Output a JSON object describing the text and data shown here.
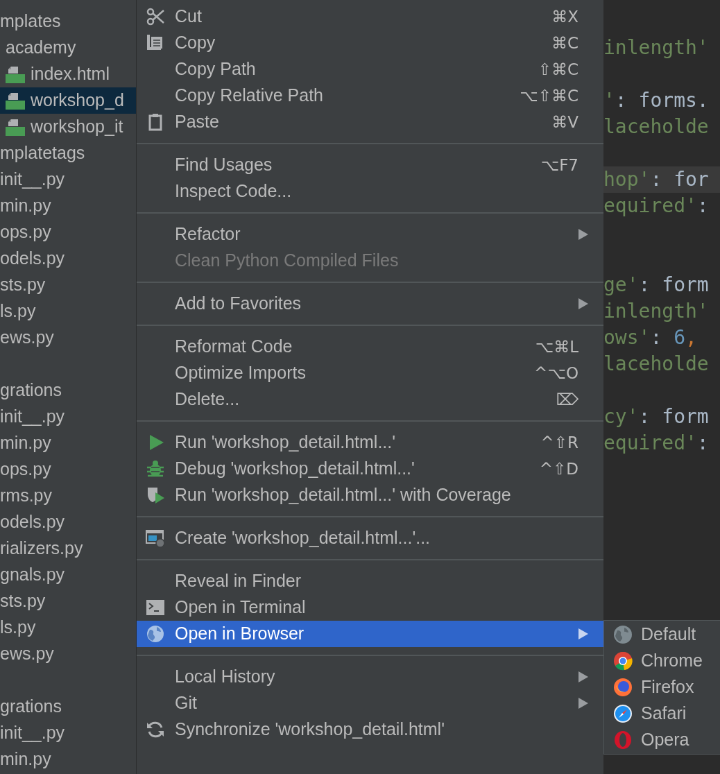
{
  "project_tree": [
    [
      {
        "label": "mplates",
        "kind": "folder",
        "selected": false
      },
      {
        "label": "academy",
        "kind": "folder",
        "selected": false
      },
      {
        "label": "index.html",
        "kind": "html",
        "selected": false
      },
      {
        "label": "workshop_d",
        "kind": "html",
        "selected": true
      },
      {
        "label": "workshop_it",
        "kind": "html",
        "selected": false
      },
      {
        "label": "mplatetags",
        "kind": "folder",
        "selected": false
      },
      {
        "label": "init__.py",
        "kind": "file",
        "selected": false
      },
      {
        "label": "min.py",
        "kind": "file",
        "selected": false
      },
      {
        "label": "ops.py",
        "kind": "file",
        "selected": false
      },
      {
        "label": "odels.py",
        "kind": "file",
        "selected": false
      },
      {
        "label": "sts.py",
        "kind": "file",
        "selected": false
      },
      {
        "label": "ls.py",
        "kind": "file",
        "selected": false
      },
      {
        "label": "ews.py",
        "kind": "file",
        "selected": false
      }
    ],
    [
      {
        "label": "grations",
        "kind": "folder",
        "selected": false
      },
      {
        "label": "init__.py",
        "kind": "file",
        "selected": false
      },
      {
        "label": "min.py",
        "kind": "file",
        "selected": false
      },
      {
        "label": "ops.py",
        "kind": "file",
        "selected": false
      },
      {
        "label": "rms.py",
        "kind": "file",
        "selected": false
      },
      {
        "label": "odels.py",
        "kind": "file",
        "selected": false
      },
      {
        "label": "rializers.py",
        "kind": "file",
        "selected": false
      },
      {
        "label": "gnals.py",
        "kind": "file",
        "selected": false
      },
      {
        "label": "sts.py",
        "kind": "file",
        "selected": false
      },
      {
        "label": "ls.py",
        "kind": "file",
        "selected": false
      },
      {
        "label": "ews.py",
        "kind": "file",
        "selected": false
      }
    ],
    [
      {
        "label": "grations",
        "kind": "folder",
        "selected": false
      },
      {
        "label": "init__.py",
        "kind": "file",
        "selected": false
      },
      {
        "label": "min.py",
        "kind": "file",
        "selected": false
      }
    ]
  ],
  "editor_blocks": [
    [
      {
        "current": false,
        "tokens": [
          {
            "kind": "str",
            "text": "inlength'"
          }
        ]
      }
    ],
    [
      {
        "current": false,
        "tokens": [
          {
            "kind": "str",
            "text": "'"
          },
          {
            "kind": "plain",
            "text": ": forms."
          }
        ]
      },
      {
        "current": false,
        "tokens": [
          {
            "kind": "str",
            "text": "laceholde"
          }
        ]
      }
    ],
    [
      {
        "current": true,
        "tokens": [
          {
            "kind": "str",
            "text": "hop'"
          },
          {
            "kind": "plain",
            "text": ": for"
          }
        ]
      },
      {
        "current": false,
        "tokens": [
          {
            "kind": "str",
            "text": "equired'"
          },
          {
            "kind": "plain",
            "text": ":"
          }
        ]
      }
    ],
    [
      {
        "current": false,
        "tokens": [
          {
            "kind": "str",
            "text": "ge'"
          },
          {
            "kind": "plain",
            "text": ": form"
          }
        ]
      },
      {
        "current": false,
        "tokens": [
          {
            "kind": "str",
            "text": "inlength'"
          }
        ]
      },
      {
        "current": false,
        "tokens": [
          {
            "kind": "str",
            "text": "ows'"
          },
          {
            "kind": "plain",
            "text": ": "
          },
          {
            "kind": "num",
            "text": "6"
          },
          {
            "kind": "punct",
            "text": ","
          }
        ]
      },
      {
        "current": false,
        "tokens": [
          {
            "kind": "str",
            "text": "laceholde"
          }
        ]
      }
    ],
    [
      {
        "current": false,
        "tokens": [
          {
            "kind": "str",
            "text": "cy'"
          },
          {
            "kind": "plain",
            "text": ": form"
          }
        ]
      },
      {
        "current": false,
        "tokens": [
          {
            "kind": "str",
            "text": "equired'"
          },
          {
            "kind": "plain",
            "text": ":"
          }
        ]
      }
    ]
  ],
  "context_menu": [
    [
      {
        "label": "Cut",
        "shortcut": "⌘X",
        "kind": "cut",
        "submenu": false,
        "disabled": false,
        "selected": false
      },
      {
        "label": "Copy",
        "shortcut": "⌘C",
        "kind": "copy",
        "submenu": false,
        "disabled": false,
        "selected": false
      },
      {
        "label": "Copy Path",
        "shortcut": "⇧⌘C",
        "kind": "plain",
        "submenu": false,
        "disabled": false,
        "selected": false
      },
      {
        "label": "Copy Relative Path",
        "shortcut": "⌥⇧⌘C",
        "kind": "plain",
        "submenu": false,
        "disabled": false,
        "selected": false
      },
      {
        "label": "Paste",
        "shortcut": "⌘V",
        "kind": "paste",
        "submenu": false,
        "disabled": false,
        "selected": false
      }
    ],
    [
      {
        "label": "Find Usages",
        "shortcut": "⌥F7",
        "kind": "plain",
        "submenu": false,
        "disabled": false,
        "selected": false
      },
      {
        "label": "Inspect Code...",
        "kind": "plain",
        "submenu": false,
        "disabled": false,
        "selected": false
      }
    ],
    [
      {
        "label": "Refactor",
        "kind": "plain",
        "submenu": true,
        "disabled": false,
        "selected": false
      },
      {
        "label": "Clean Python Compiled Files",
        "kind": "plain",
        "submenu": false,
        "disabled": true,
        "selected": false
      }
    ],
    [
      {
        "label": "Add to Favorites",
        "kind": "plain",
        "submenu": true,
        "disabled": false,
        "selected": false
      }
    ],
    [
      {
        "label": "Reformat Code",
        "shortcut": "⌥⌘L",
        "kind": "plain",
        "submenu": false,
        "disabled": false,
        "selected": false
      },
      {
        "label": "Optimize Imports",
        "shortcut": "^⌥O",
        "kind": "plain",
        "submenu": false,
        "disabled": false,
        "selected": false
      },
      {
        "label": "Delete...",
        "shortcut": "⌦",
        "kind": "plain",
        "submenu": false,
        "disabled": false,
        "selected": false
      }
    ],
    [
      {
        "label": "Run 'workshop_detail.html...'",
        "shortcut": "^⇧R",
        "kind": "run",
        "submenu": false,
        "disabled": false,
        "selected": false
      },
      {
        "label": "Debug 'workshop_detail.html...'",
        "shortcut": "^⇧D",
        "kind": "debug",
        "submenu": false,
        "disabled": false,
        "selected": false
      },
      {
        "label": "Run 'workshop_detail.html...' with Coverage",
        "kind": "coverage",
        "submenu": false,
        "disabled": false,
        "selected": false
      }
    ],
    [
      {
        "label": "Create 'workshop_detail.html...'...",
        "kind": "create",
        "submenu": false,
        "disabled": false,
        "selected": false
      }
    ],
    [
      {
        "label": "Reveal in Finder",
        "kind": "plain",
        "submenu": false,
        "disabled": false,
        "selected": false
      },
      {
        "label": "Open in Terminal",
        "kind": "terminal",
        "submenu": false,
        "disabled": false,
        "selected": false
      },
      {
        "label": "Open in Browser",
        "kind": "globe",
        "submenu": true,
        "disabled": false,
        "selected": true
      }
    ],
    [
      {
        "label": "Local History",
        "kind": "plain",
        "submenu": true,
        "disabled": false,
        "selected": false
      },
      {
        "label": "Git",
        "kind": "plain",
        "submenu": true,
        "disabled": false,
        "selected": false
      },
      {
        "label": "Synchronize 'workshop_detail.html'",
        "kind": "sync",
        "submenu": false,
        "disabled": false,
        "selected": false
      }
    ]
  ],
  "browser_submenu": [
    {
      "label": "Default",
      "kind": "default"
    },
    {
      "label": "Chrome",
      "kind": "chrome"
    },
    {
      "label": "Firefox",
      "kind": "firefox"
    },
    {
      "label": "Safari",
      "kind": "safari"
    },
    {
      "label": "Opera",
      "kind": "opera"
    }
  ]
}
